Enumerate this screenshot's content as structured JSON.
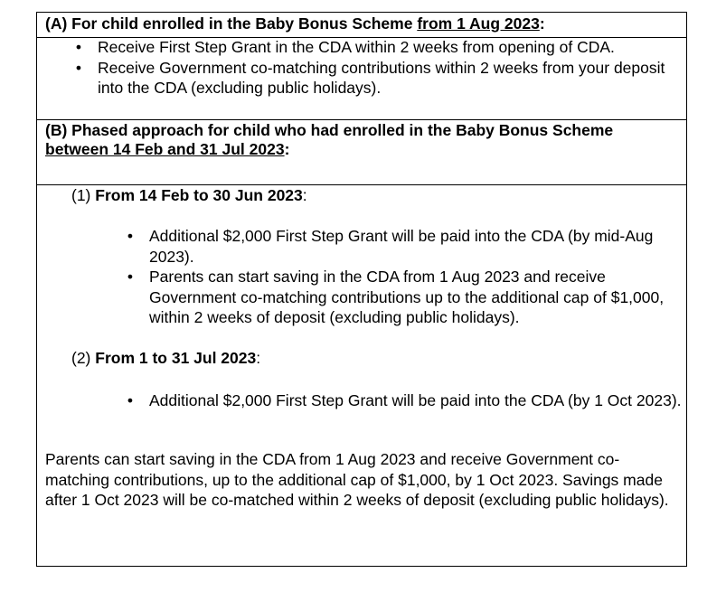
{
  "sectionA": {
    "label": "(A) For child enrolled in the Baby Bonus Scheme ",
    "date": "from 1 Aug 2023",
    "colon": ":",
    "bullets": [
      "Receive First Step Grant in the CDA within 2 weeks from opening of CDA.",
      "Receive Government co-matching contributions within 2 weeks from your deposit into the CDA (excluding public holidays)."
    ]
  },
  "sectionB": {
    "label": "(B) Phased approach for child who had enrolled in the Baby Bonus Scheme ",
    "dates": "between 14 Feb and 31 Jul 2023",
    "colon": ":",
    "phase1": {
      "num": "(1) ",
      "title": "From 14 Feb to 30 Jun 2023",
      "colon": ":",
      "bullets": [
        "Additional $2,000 First Step Grant will be paid into the CDA (by mid-Aug 2023).",
        "Parents can start saving in the CDA from 1 Aug 2023 and receive Government co-matching contributions up to the additional cap of $1,000, within 2 weeks of deposit (excluding public holidays)."
      ]
    },
    "phase2": {
      "num": "(2) ",
      "title": "From 1 to 31 Jul 2023",
      "colon": ":",
      "bullets": [
        "Additional $2,000 First Step Grant will be paid into the CDA (by 1 Oct 2023)."
      ]
    },
    "note": "Parents can start saving in the CDA from 1 Aug 2023 and receive Government co-matching contributions, up to the additional cap of $1,000, by 1 Oct 2023. Savings made after 1 Oct 2023 will be co-matched within 2 weeks of deposit (excluding public holidays)."
  },
  "bullet_glyph": "•"
}
